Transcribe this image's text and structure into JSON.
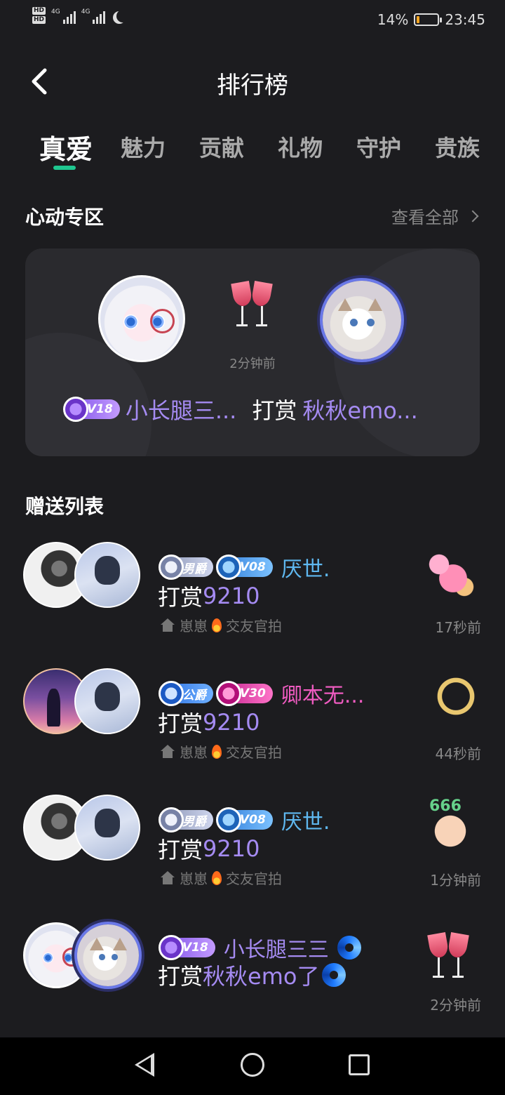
{
  "status_bar": {
    "hd1": "HD",
    "hd2": "HD",
    "net1": "4G",
    "net2": "4G",
    "battery_pct": "14%",
    "battery_level": 0.14,
    "time": "23:45"
  },
  "header": {
    "title": "排行榜"
  },
  "tabs": [
    {
      "label": "真爱",
      "active": true
    },
    {
      "label": "魅力"
    },
    {
      "label": "贡献"
    },
    {
      "label": "礼物"
    },
    {
      "label": "守护"
    },
    {
      "label": "贵族"
    }
  ],
  "heart_zone": {
    "title": "心动专区",
    "see_all": "查看全部",
    "time": "2分钟前",
    "badge": "V18",
    "sender": "小长腿三...",
    "action": "打赏",
    "receiver": "秋秋emo..."
  },
  "gift_list": {
    "title": "赠送列表",
    "items": [
      {
        "badge1": "男爵",
        "badge2": "V08",
        "name": "厌世.",
        "action": "打赏",
        "target": "9210",
        "room_a": "崽崽",
        "room_b": "交友官拍",
        "time": "17秒前"
      },
      {
        "badge1": "公爵",
        "badge2": "V30",
        "name": "卿本无...",
        "action": "打赏",
        "target": "9210",
        "room_a": "崽崽",
        "room_b": "交友官拍",
        "time": "44秒前"
      },
      {
        "badge1": "男爵",
        "badge2": "V08",
        "name": "厌世.",
        "action": "打赏",
        "target": "9210",
        "room_a": "崽崽",
        "room_b": "交友官拍",
        "time": "1分钟前"
      },
      {
        "badge1": "V18",
        "name": "小长腿三三",
        "action": "打赏",
        "target": "秋秋emo了",
        "time": "2分钟前"
      }
    ]
  },
  "gift_666": "666",
  "colors": {
    "background": "#1c1c1f",
    "accent_green": "#1fc790",
    "purple_name": "#a58bf2",
    "blue_name": "#5fb8f0",
    "pink_name": "#ee5bc0"
  }
}
